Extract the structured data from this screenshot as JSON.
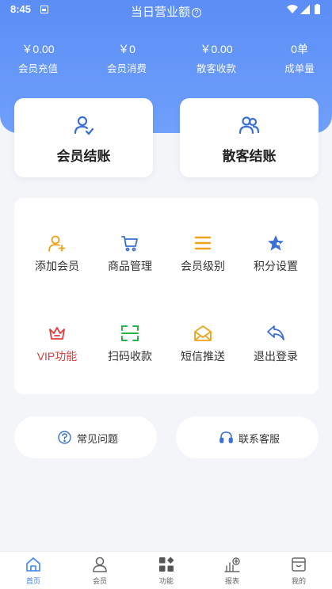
{
  "status_bar": {
    "time": "8:45"
  },
  "header": {
    "title": "当日营业额",
    "help_glyph": "?"
  },
  "stats": [
    {
      "value": "￥0.00",
      "label": "会员充值"
    },
    {
      "value": "￥0",
      "label": "会员消费"
    },
    {
      "value": "￥0.00",
      "label": "散客收款"
    },
    {
      "value": "0单",
      "label": "成单量"
    }
  ],
  "checkout": [
    {
      "label": "会员结账",
      "icon": "member-checkout-icon"
    },
    {
      "label": "散客结账",
      "icon": "guest-checkout-icon"
    }
  ],
  "functions": [
    {
      "label": "添加会员",
      "icon": "add-user-icon"
    },
    {
      "label": "商品管理",
      "icon": "cart-icon"
    },
    {
      "label": "会员级别",
      "icon": "list-icon"
    },
    {
      "label": "积分设置",
      "icon": "star-icon"
    },
    {
      "label": "VIP功能",
      "icon": "crown-icon"
    },
    {
      "label": "扫码收款",
      "icon": "scan-icon"
    },
    {
      "label": "短信推送",
      "icon": "mail-icon"
    },
    {
      "label": "退出登录",
      "icon": "back-arrow-icon"
    }
  ],
  "support": [
    {
      "label": "常见问题",
      "icon": "question-icon"
    },
    {
      "label": "联系客服",
      "icon": "headset-icon"
    }
  ],
  "tabbar": [
    {
      "label": "首页",
      "icon": "home-icon",
      "active": true
    },
    {
      "label": "会员",
      "icon": "user-icon",
      "active": false
    },
    {
      "label": "功能",
      "icon": "apps-icon",
      "active": false
    },
    {
      "label": "报表",
      "icon": "report-icon",
      "active": false
    },
    {
      "label": "我的",
      "icon": "shop-icon",
      "active": false
    }
  ],
  "colors": {
    "header_blue": "#5b8df6",
    "icon_blue": "#3b6fd8",
    "icon_orange": "#f2a11a",
    "vip_red": "#e23b3b",
    "scan_green": "#2bb24c",
    "active_tab": "#3b82f6",
    "background": "#f3f5f9"
  }
}
